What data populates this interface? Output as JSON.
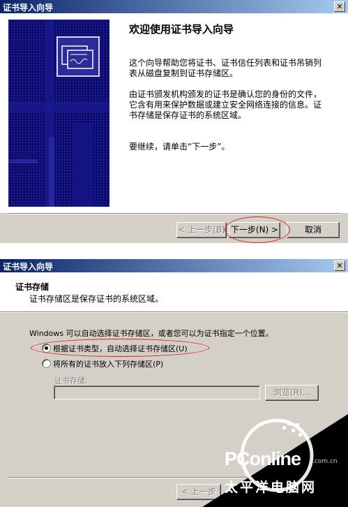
{
  "wizard1": {
    "title": "证书导入向导",
    "heading": "欢迎使用证书导入向导",
    "para1": "这个向导帮助您将证书、证书信任列表和证书吊销列表从磁盘复制到证书存储区。",
    "para2": "由证书颁发机构颁发的证书是确认您的身份的文件，它含有用来保护数据或建立安全网络连接的信息。证书存储是保存证书的系统区域。",
    "para3": "要继续，请单击“下一步”。",
    "back_button": "< 上一步(B)",
    "next_button": "下一步(N) >",
    "cancel_button": "取消"
  },
  "wizard2": {
    "title": "证书导入向导",
    "section_title": "证书存储",
    "section_desc": "证书存储区是保存证书的系统区域。",
    "intro": "Windows 可以自动选择证书存储区，或者您可以为证书指定一个位置。",
    "option_auto": "根据证书类型，自动选择证书存储区(U)",
    "option_manual": "将所有的证书放入下列存储区(P)",
    "store_label": "证书存储:",
    "store_value": "",
    "browse_button": "浏览(R)...",
    "back_button": "< 上一步"
  },
  "watermark": {
    "brand": "PConline",
    "domain": ".com.cn",
    "tagline": "太平洋电脑网"
  },
  "colors": {
    "title_start": "#0a246a",
    "title_end": "#a6caf0",
    "dialog_bg": "#d4d0c8",
    "banner": "#0a0a6e",
    "annotation_red": "#d9201c"
  }
}
